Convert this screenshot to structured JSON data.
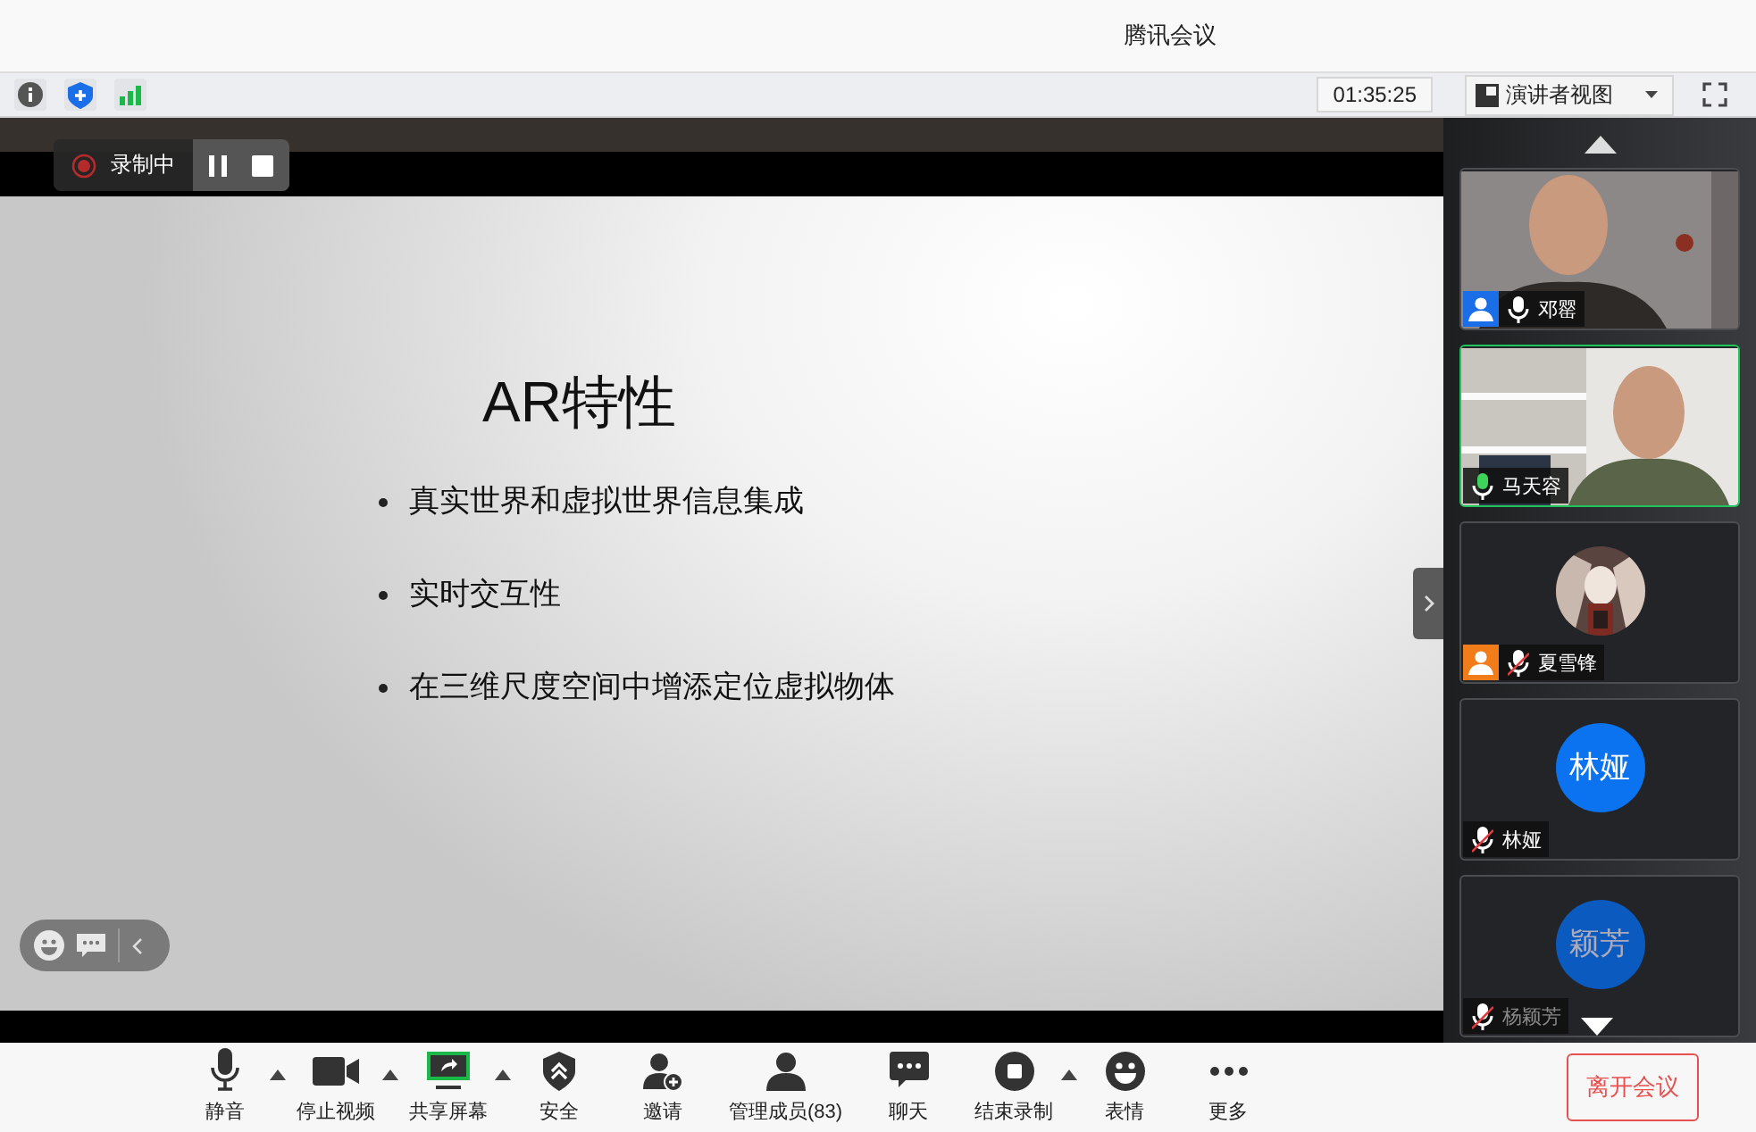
{
  "window": {
    "title": "腾讯会议"
  },
  "status_bar": {
    "timer": "01:35:25",
    "view_button": "演讲者视图"
  },
  "recording": {
    "label": "录制中",
    "paused": false
  },
  "slide": {
    "title": "AR特性",
    "bullets": [
      "真实世界和虚拟世界信息集成",
      "实时交互性",
      "在三维尺度空间中增添定位虚拟物体"
    ]
  },
  "participants": [
    {
      "name": "邓罂",
      "kind": "video",
      "color": "#1a6fe8",
      "muted": false,
      "speaking": false,
      "selected": false,
      "dimmed": false
    },
    {
      "name": "马天容",
      "kind": "video",
      "muted": false,
      "speaking": true,
      "selected": true,
      "dimmed": false
    },
    {
      "name": "夏雪锋",
      "kind": "avatar",
      "color": "#f07d1a",
      "muted": true,
      "speaking": false,
      "selected": false,
      "dimmed": false
    },
    {
      "name": "林娅",
      "kind": "initials",
      "avatar_text": "林娅",
      "muted": true,
      "speaking": false,
      "selected": false,
      "dimmed": false
    },
    {
      "name": "杨颖芳",
      "kind": "initials",
      "avatar_text": "颖芳",
      "muted": true,
      "speaking": false,
      "selected": false,
      "dimmed": true
    }
  ],
  "toolbar": [
    {
      "label": "静音",
      "kind": "mic",
      "has_menu": true
    },
    {
      "label": "停止视频",
      "kind": "camera",
      "has_menu": true
    },
    {
      "label": "共享屏幕",
      "kind": "share",
      "has_menu": true
    },
    {
      "label": "安全",
      "kind": "security",
      "has_menu": false
    },
    {
      "label": "邀请",
      "kind": "invite",
      "has_menu": false
    },
    {
      "label": "管理成员(83)",
      "kind": "members",
      "has_menu": false
    },
    {
      "label": "聊天",
      "kind": "chat",
      "has_menu": false
    },
    {
      "label": "结束录制",
      "kind": "record",
      "has_menu": true
    },
    {
      "label": "表情",
      "kind": "emoji",
      "has_menu": false
    },
    {
      "label": "更多",
      "kind": "more",
      "has_menu": false
    }
  ],
  "leave_button": "离开会议"
}
